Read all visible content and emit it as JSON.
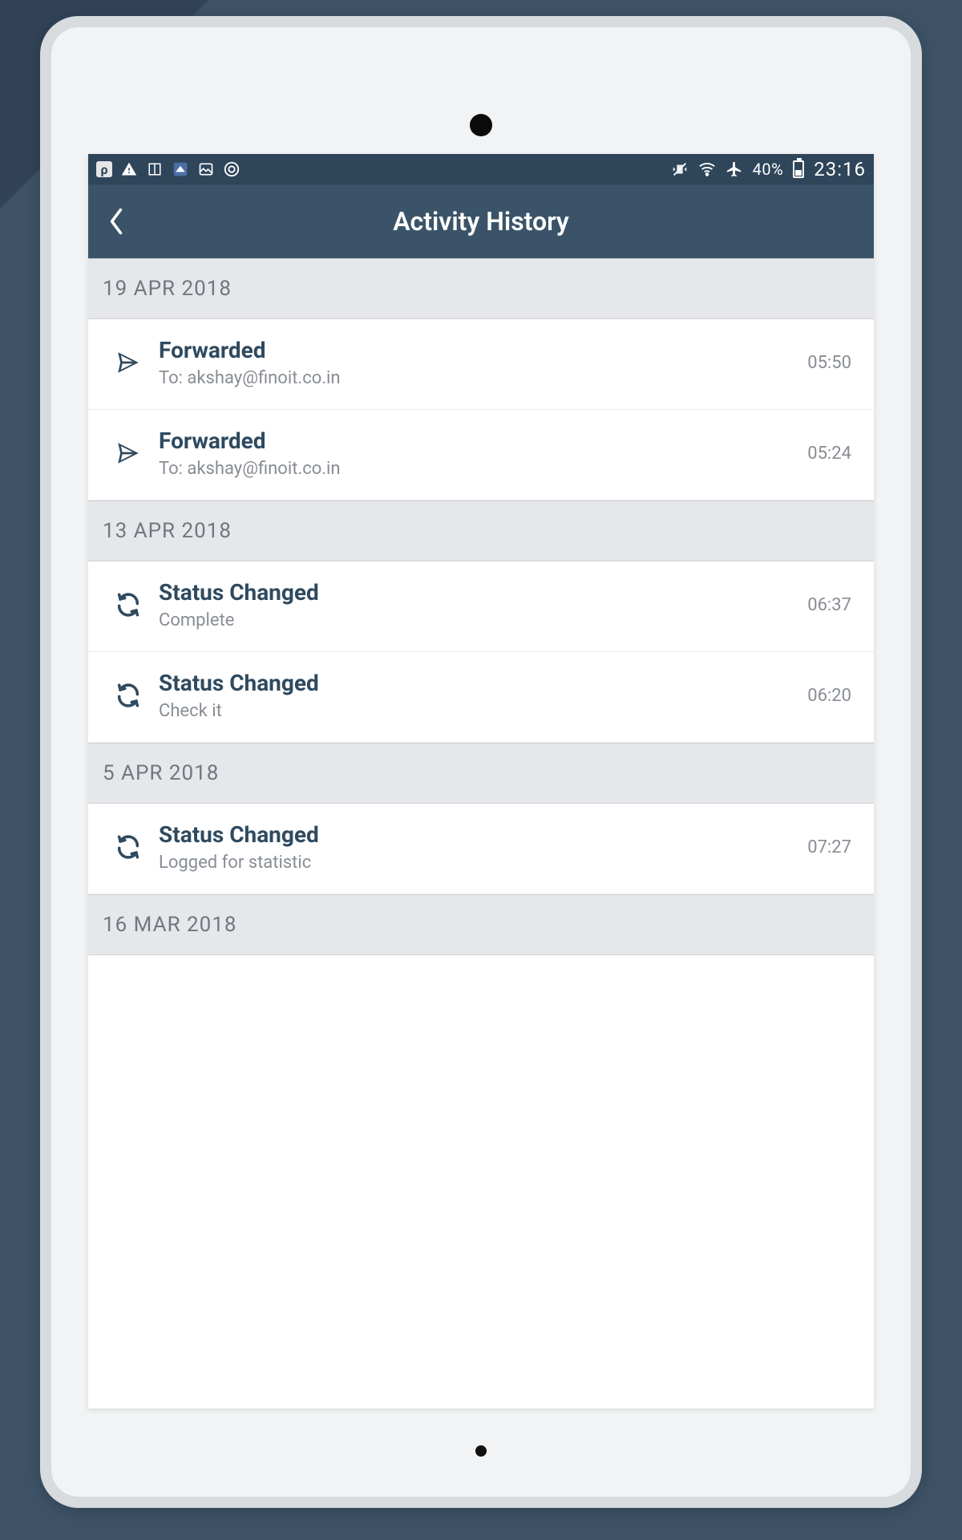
{
  "status_bar": {
    "battery_text": "40%",
    "time": "23:16"
  },
  "header": {
    "title": "Activity History"
  },
  "sections": [
    {
      "date": "19 APR 2018",
      "items": [
        {
          "icon": "send",
          "title": "Forwarded",
          "subtitle": "To: akshay@finoit.co.in",
          "time": "05:50"
        },
        {
          "icon": "send",
          "title": "Forwarded",
          "subtitle": "To: akshay@finoit.co.in",
          "time": "05:24"
        }
      ]
    },
    {
      "date": "13 APR 2018",
      "items": [
        {
          "icon": "sync",
          "title": "Status Changed",
          "subtitle": "Complete",
          "time": "06:37"
        },
        {
          "icon": "sync",
          "title": "Status Changed",
          "subtitle": "Check it",
          "time": "06:20"
        }
      ]
    },
    {
      "date": "5 APR 2018",
      "items": [
        {
          "icon": "sync",
          "title": "Status Changed",
          "subtitle": "Logged for statistic",
          "time": "07:27"
        }
      ]
    },
    {
      "date": "16 MAR 2018",
      "items": []
    }
  ]
}
